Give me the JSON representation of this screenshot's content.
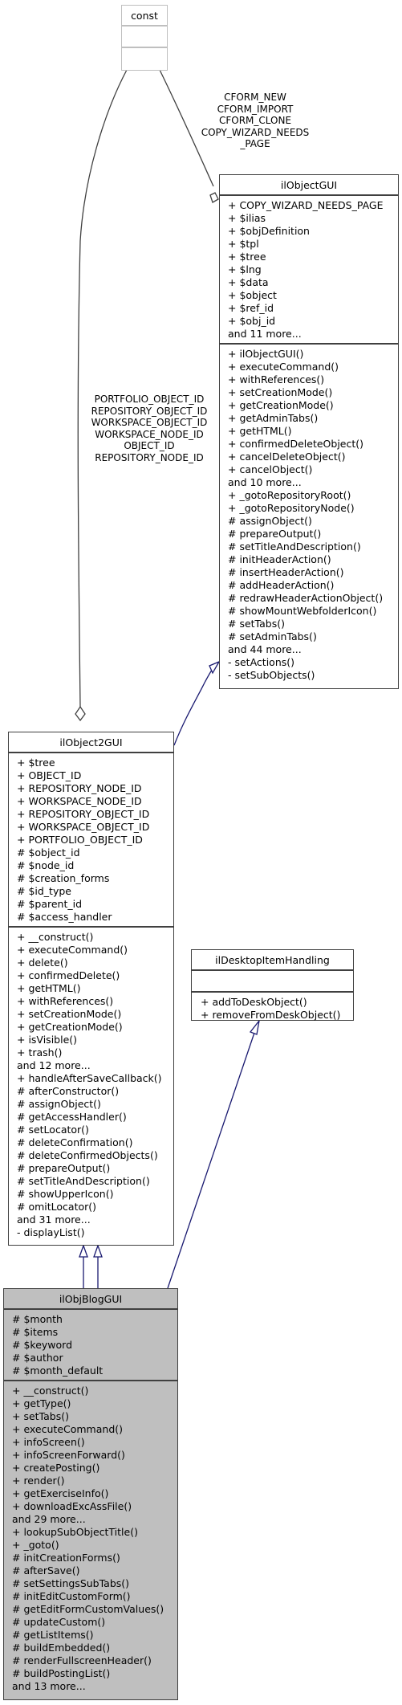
{
  "classes": {
    "const": {
      "name": "const",
      "attributes": [],
      "methods": []
    },
    "ilObjectGUI": {
      "name": "ilObjectGUI",
      "attributes": [
        "+ COPY_WIZARD_NEEDS_PAGE",
        "+ $ilias",
        "+ $objDefinition",
        "+ $tpl",
        "+ $tree",
        "+ $lng",
        "+ $data",
        "+ $object",
        "+ $ref_id",
        "+ $obj_id",
        "and 11 more..."
      ],
      "methods": [
        "+ ilObjectGUI()",
        "+ executeCommand()",
        "+ withReferences()",
        "+ setCreationMode()",
        "+ getCreationMode()",
        "+ getAdminTabs()",
        "+ getHTML()",
        "+ confirmedDeleteObject()",
        "+ cancelDeleteObject()",
        "+ cancelObject()",
        "and 10 more...",
        "+ _gotoRepositoryRoot()",
        "+ _gotoRepositoryNode()",
        "# assignObject()",
        "# prepareOutput()",
        "# setTitleAndDescription()",
        "# initHeaderAction()",
        "# insertHeaderAction()",
        "# addHeaderAction()",
        "# redrawHeaderActionObject()",
        "# showMountWebfolderIcon()",
        "# setTabs()",
        "# setAdminTabs()",
        "and 44 more...",
        "- setActions()",
        "- setSubObjects()"
      ]
    },
    "ilObject2GUI": {
      "name": "ilObject2GUI",
      "attributes": [
        "+ $tree",
        "+ OBJECT_ID",
        "+ REPOSITORY_NODE_ID",
        "+ WORKSPACE_NODE_ID",
        "+ REPOSITORY_OBJECT_ID",
        "+ WORKSPACE_OBJECT_ID",
        "+ PORTFOLIO_OBJECT_ID",
        "# $object_id",
        "# $node_id",
        "# $creation_forms",
        "# $id_type",
        "# $parent_id",
        "# $access_handler"
      ],
      "methods": [
        "+ __construct()",
        "+ executeCommand()",
        "+ delete()",
        "+ confirmedDelete()",
        "+ getHTML()",
        "+ withReferences()",
        "+ setCreationMode()",
        "+ getCreationMode()",
        "+ isVisible()",
        "+ trash()",
        "and 12 more...",
        "+ handleAfterSaveCallback()",
        "# afterConstructor()",
        "# assignObject()",
        "# getAccessHandler()",
        "# setLocator()",
        "# deleteConfirmation()",
        "# deleteConfirmedObjects()",
        "# prepareOutput()",
        "# setTitleAndDescription()",
        "# showUpperIcon()",
        "# omitLocator()",
        "and 31 more...",
        "- displayList()"
      ]
    },
    "ilDesktopItemHandling": {
      "name": "ilDesktopItemHandling",
      "attributes": [],
      "methods": [
        "+ addToDeskObject()",
        "+ removeFromDeskObject()"
      ]
    },
    "ilObjBlogGUI": {
      "name": "ilObjBlogGUI",
      "attributes": [
        "# $month",
        "# $items",
        "# $keyword",
        "# $author",
        "# $month_default"
      ],
      "methods": [
        "+ __construct()",
        "+ getType()",
        "+ setTabs()",
        "+ executeCommand()",
        "+ infoScreen()",
        "+ infoScreenForward()",
        "+ createPosting()",
        "+ render()",
        "+ getExerciseInfo()",
        "+ downloadExcAssFile()",
        "and 29 more...",
        "+ lookupSubObjectTitle()",
        "+ _goto()",
        "# initCreationForms()",
        "# afterSave()",
        "# setSettingsSubTabs()",
        "# initEditCustomForm()",
        "# getEditFormCustomValues()",
        "# updateCustom()",
        "# getListItems()",
        "# buildEmbedded()",
        "# renderFullscreenHeader()",
        "# buildPostingList()",
        "and 13 more..."
      ]
    }
  },
  "edge_labels": {
    "const_to_ilObjectGUI": [
      "CFORM_NEW",
      "CFORM_IMPORT",
      "CFORM_CLONE",
      "COPY_WIZARD_NEEDS",
      "_PAGE"
    ],
    "const_to_ilObject2GUI": [
      "PORTFOLIO_OBJECT_ID",
      "REPOSITORY_OBJECT_ID",
      "WORKSPACE_OBJECT_ID",
      "WORKSPACE_NODE_ID",
      "OBJECT_ID",
      "REPOSITORY_NODE_ID"
    ]
  },
  "colors": {
    "inheritance_edge": "#191970",
    "usage_edge": "#404040",
    "focus_class_fill": "#bfbfbf",
    "external_class_border": "#bfbfbf"
  }
}
